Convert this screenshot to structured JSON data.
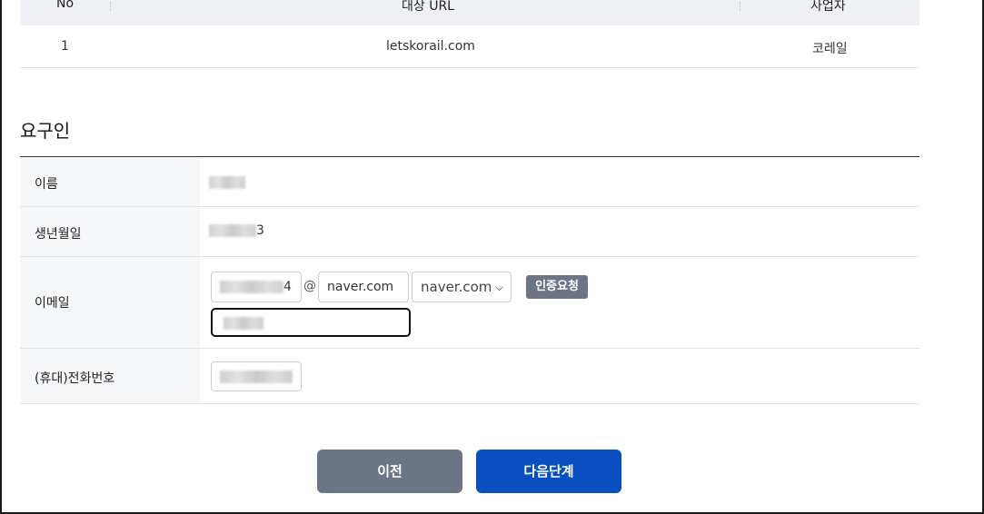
{
  "target_table": {
    "headers": {
      "no": "No",
      "url": "대상 URL",
      "business": "사업자"
    },
    "rows": [
      {
        "no": "1",
        "url": "letskorail.com",
        "business": "코레일"
      }
    ]
  },
  "requester": {
    "title": "요구인",
    "fields": {
      "name": {
        "label": "이름"
      },
      "birth": {
        "label": "생년월일",
        "value_tail": "3"
      },
      "email": {
        "label": "이메일",
        "local_tail": "4",
        "at_symbol": "@",
        "domain_value": "naver.com",
        "domain_select": "naver.com",
        "auth_button": "인증요청"
      },
      "phone": {
        "label": "(휴대)전화번호"
      }
    }
  },
  "actions": {
    "prev": "이전",
    "next": "다음단계"
  },
  "colors": {
    "primary": "#0a4fc2",
    "secondary": "#6b7585"
  }
}
